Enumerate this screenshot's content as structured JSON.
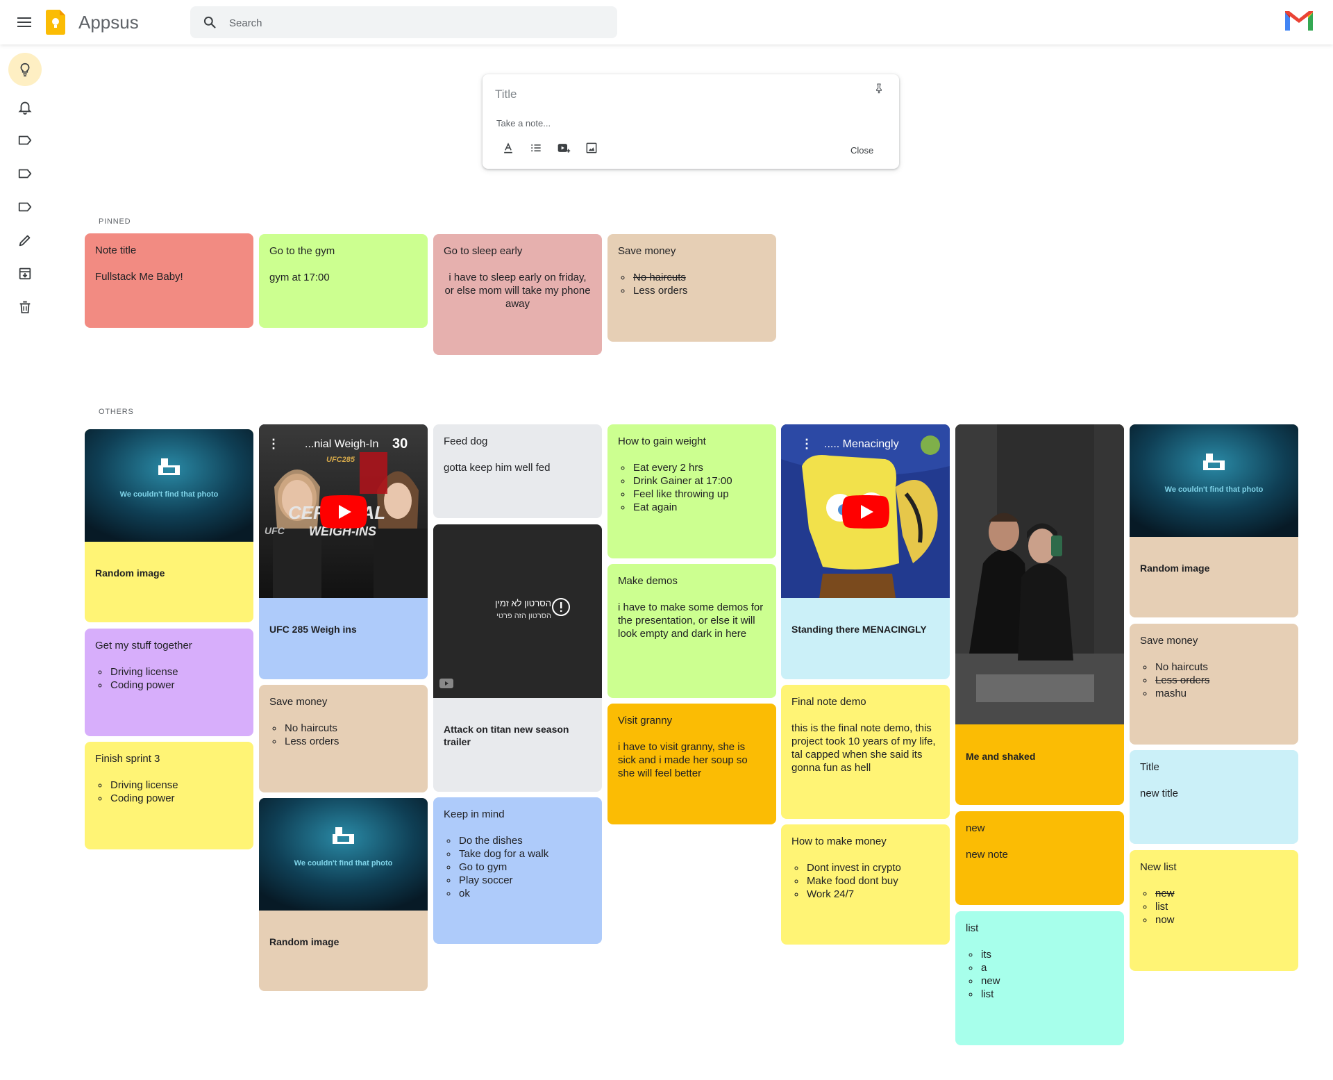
{
  "header": {
    "app_title": "Appsus",
    "search_placeholder": "Search"
  },
  "composer": {
    "title_placeholder": "Title",
    "body_placeholder": "Take a note...",
    "close_label": "Close"
  },
  "sections": {
    "pinned": "PINNED",
    "others": "OTHERS"
  },
  "colors": {
    "red": "#f28b82",
    "green": "#ccff90",
    "pink": "#e6b0ae",
    "beige": "#e6cfb5",
    "yellow": "#fff475",
    "purple": "#d7aefb",
    "blue": "#aecbfa",
    "gray": "#e8eaed",
    "orange": "#fbbc04",
    "cyan": "#cbf0f8",
    "teal": "#a7ffeb"
  },
  "pinned": [
    {
      "title": "Note title",
      "text": "Fullstack Me Baby!"
    },
    {
      "title": "Go to the gym",
      "text": "gym at 17:00"
    },
    {
      "title": "Go to sleep early",
      "text": "i have to sleep early on friday, or else mom will take my phone away"
    },
    {
      "title": "Save money",
      "items": [
        "No haircuts",
        "Less orders"
      ]
    }
  ],
  "others": {
    "random_image_1": {
      "caption": "Random image",
      "placeholder_text": "We couldn't find that photo"
    },
    "stuff_together": {
      "title": "Get my stuff together",
      "items": [
        "Driving license",
        "Coding power"
      ]
    },
    "finish_sprint": {
      "title": "Finish sprint 3",
      "items": [
        "Driving license",
        "Coding power"
      ]
    },
    "ufc_video": {
      "caption": "UFC 285 Weigh ins",
      "video_title": "...nial Weigh-In",
      "badge": "30",
      "overlay_top": "UFC285",
      "overlay_big": "CER      IAL",
      "overlay_sub": "WEIGH-INS",
      "overlay_ufc": "UFC"
    },
    "save_money_2": {
      "title": "Save money",
      "items": [
        "No haircuts",
        "Less orders"
      ]
    },
    "random_image_2": {
      "caption": "Random image",
      "placeholder_text": "We couldn't find that photo"
    },
    "feed_dog": {
      "title": "Feed dog",
      "text": "gotta keep him well fed"
    },
    "aot_video": {
      "caption": "Attack on titan new season trailer",
      "unavailable_line1": "הסרטון לא זמין",
      "unavailable_line2": "הסרטון הזה פרטי"
    },
    "keep_in_mind": {
      "title": "Keep in mind",
      "items": [
        "Do the dishes",
        "Take dog for a walk",
        "Go to gym",
        "Play soccer",
        "ok"
      ]
    },
    "gain_weight": {
      "title": "How to gain weight",
      "items": [
        "Eat every 2 hrs",
        "Drink Gainer at 17:00",
        "Feel like throwing up",
        "Eat again"
      ]
    },
    "make_demos": {
      "title": "Make demos",
      "text": "i have to make some demos for the presentation, or else it will look empty and dark in here"
    },
    "visit_granny": {
      "title": "Visit granny",
      "text": "i have to visit granny, she is sick and i made her soup so she will feel better"
    },
    "sponge_video": {
      "caption": "Standing there MENACINGLY",
      "video_title": "..... Menacingly"
    },
    "final_demo": {
      "title": "Final note demo",
      "text": "this is the final note demo, this project took 10 years of my life, tal capped when she said its gonna fun as hell"
    },
    "make_money": {
      "title": "How to make money",
      "items": [
        "Dont invest in crypto",
        "Make food dont buy",
        "Work 24/7"
      ]
    },
    "me_shaked": {
      "caption": "Me and shaked"
    },
    "new_note": {
      "title": "new",
      "text": "new note"
    },
    "list_note": {
      "title": "list",
      "items": [
        "its",
        "a",
        "new",
        "list"
      ]
    },
    "random_image_3": {
      "caption": "Random image",
      "placeholder_text": "We couldn't find that photo"
    },
    "save_money_3": {
      "title": "Save money",
      "items": [
        "No haircuts",
        "Less orders",
        "mashu"
      ]
    },
    "title_note": {
      "title": "Title",
      "text": "new title"
    },
    "new_list": {
      "title": "New list",
      "items": [
        "new",
        "list",
        "now"
      ]
    }
  }
}
